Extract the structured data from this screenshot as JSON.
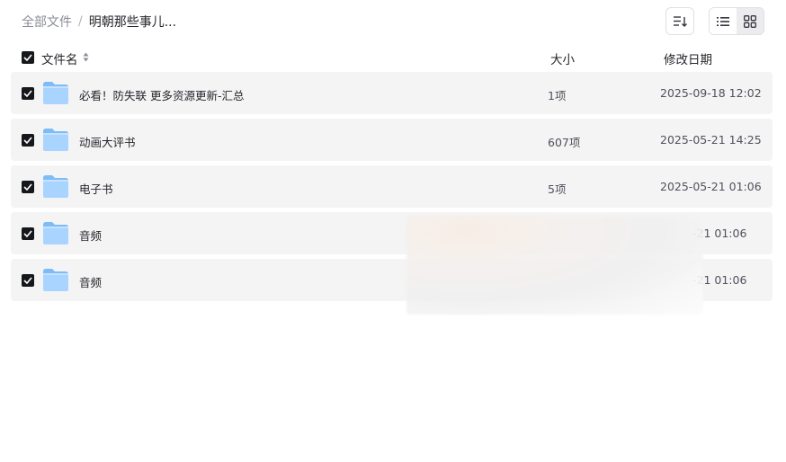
{
  "breadcrumb": {
    "root": "全部文件",
    "separator": "/",
    "current": "明朝那些事儿..."
  },
  "toolbar": {
    "sort_icon": "sort-lines-icon",
    "view_list_icon": "list-view-icon",
    "view_grid_icon": "grid-view-icon",
    "active_view": "list"
  },
  "table": {
    "headers": {
      "name": "文件名",
      "size": "大小",
      "date": "修改日期"
    },
    "all_selected": true,
    "rows": [
      {
        "name": "必看！防失联 更多资源更新-汇总",
        "size": "1项",
        "date": "2025-09-18 12:02",
        "selected": true
      },
      {
        "name": "动画大评书",
        "size": "607项",
        "date": "2025-05-21 14:25",
        "selected": true
      },
      {
        "name": "电子书",
        "size": "5项",
        "date": "2025-05-21 01:06",
        "selected": true
      },
      {
        "name": "音频",
        "size": "",
        "date": "-21 01:06",
        "selected": true
      },
      {
        "name": "音频",
        "size": "",
        "date": "-21 01:06",
        "selected": true
      }
    ]
  },
  "colors": {
    "row_bg": "#f4f4f5",
    "checkbox": "#16171a",
    "folder_light": "#a9d4ff",
    "folder_dark": "#7dbcf7"
  }
}
